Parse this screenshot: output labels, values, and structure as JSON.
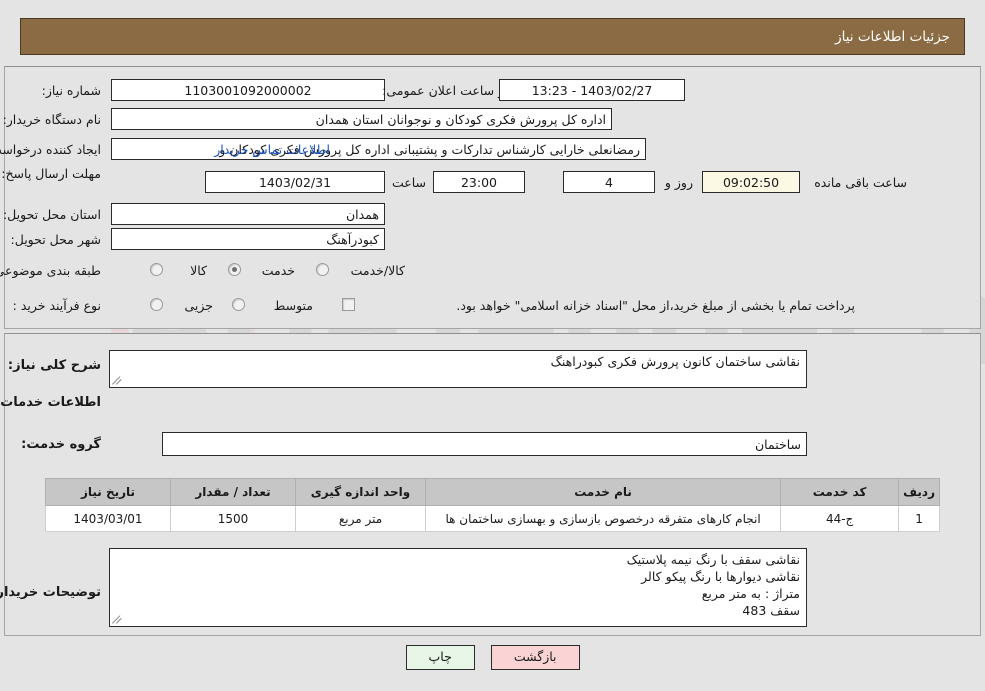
{
  "header": {
    "title": "جزئیات اطلاعات نیاز"
  },
  "watermark": {
    "text": "AriaTender.net",
    "shield_color": "#e8b8bc",
    "text_color": "#b9b9b9"
  },
  "top_form": {
    "need_number": {
      "label": "شماره نیاز:",
      "value": "1103001092000002"
    },
    "public_announcement": {
      "label": "تاریخ و ساعت اعلان عمومی:",
      "value": "1403/02/27 - 13:23"
    },
    "buyer_org": {
      "label": "نام دستگاه خریدار:",
      "value": "اداره کل پرورش فکری کودکان و نوجوانان استان همدان"
    },
    "requester": {
      "label": "ایجاد کننده درخواست:",
      "value": "رمضانعلی خارایی کارشناس تدارکات و پشتیبانی اداره کل پرورش فکری کودکان و",
      "contact_link": "اطلاعات تماس خریدار"
    },
    "deadline": {
      "label": "مهلت ارسال پاسخ: تا تاریخ:",
      "date": "1403/02/31",
      "time_label": "ساعت",
      "time": "23:00",
      "days": "4",
      "days_label": "روز و",
      "countdown": "09:02:50",
      "countdown_label": "ساعت باقی مانده"
    },
    "delivery_province": {
      "label": "استان محل تحویل:",
      "value": "همدان"
    },
    "delivery_city": {
      "label": "شهر محل تحویل:",
      "value": "کبودرآهنگ"
    },
    "category": {
      "label": "طبقه بندی موضوعی:",
      "options": [
        {
          "label": "کالا",
          "selected": false
        },
        {
          "label": "خدمت",
          "selected": true
        },
        {
          "label": "کالا/خدمت",
          "selected": false
        }
      ]
    },
    "purchase_type": {
      "label": "نوع فرآیند خرید :",
      "options": [
        {
          "label": "جزیی",
          "selected": false
        },
        {
          "label": "متوسط",
          "selected": false
        }
      ],
      "checkbox_label": "پرداخت تمام یا بخشی از مبلغ خرید،از محل \"اسناد خزانه اسلامی\" خواهد بود.",
      "checkbox_checked": false
    }
  },
  "middle": {
    "general_desc": {
      "label": "شرح کلی نیاز:",
      "value": "نقاشی ساختمان کانون پرورش فکری کبودراهنگ"
    },
    "section_title": "اطلاعات خدمات مورد نیاز",
    "service_group": {
      "label": "گروه خدمت:",
      "value": "ساختمان"
    },
    "table": {
      "headers": [
        "ردیف",
        "کد خدمت",
        "نام خدمت",
        "واحد اندازه گیری",
        "تعداد / مقدار",
        "تاریخ نیاز"
      ],
      "rows": [
        {
          "row": "1",
          "code": "ج-44",
          "name": "انجام کارهای متفرقه درخصوص بازسازی و بهسازی ساختمان ها",
          "unit": "متر مربع",
          "qty": "1500",
          "date": "1403/03/01"
        }
      ]
    },
    "buyer_notes": {
      "label": "توضیحات خریدار:",
      "lines": [
        "نقاشی سقف با رنگ نیمه پلاستیک",
        "نقاشی دیوارها با رنگ پیکو کالر",
        "متراژ : به متر مربع",
        "سقف 483"
      ]
    }
  },
  "footer": {
    "print_button": "چاپ",
    "back_button": "بازگشت"
  }
}
